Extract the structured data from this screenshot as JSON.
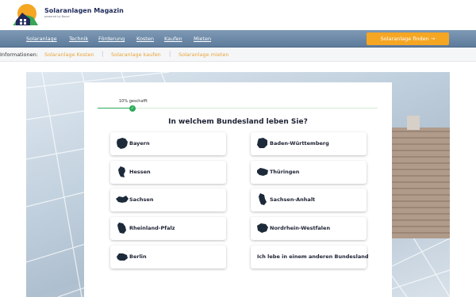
{
  "brand": {
    "title": "Solaranlagen Magazin",
    "subtitle": "powered by Bauer"
  },
  "nav": {
    "items": [
      "Solaranlage",
      "Technik",
      "Förderung",
      "Kosten",
      "Kaufen",
      "Mieten"
    ],
    "cta_label": "Solaranlage finden",
    "cta_arrow": "→"
  },
  "infobar": {
    "label": "Informationen:",
    "links": [
      "Solaranlage Kosten",
      "Solaranlage kaufen",
      "Solaranlage mieten"
    ],
    "separator": "|"
  },
  "quiz": {
    "progress_label": "10% geschafft",
    "progress_percent": 10,
    "progress_check": "✓",
    "question": "In welchem Bundesland leben Sie?",
    "options": [
      {
        "label": "Bayern",
        "icon": "bayern-map-icon"
      },
      {
        "label": "Baden-Württemberg",
        "icon": "baden-wuerttemberg-map-icon"
      },
      {
        "label": "Hessen",
        "icon": "hessen-map-icon"
      },
      {
        "label": "Thüringen",
        "icon": "thueringen-map-icon"
      },
      {
        "label": "Sachsen",
        "icon": "sachsen-map-icon"
      },
      {
        "label": "Sachsen-Anhalt",
        "icon": "sachsen-anhalt-map-icon"
      },
      {
        "label": "Rheinland-Pfalz",
        "icon": "rheinland-pfalz-map-icon"
      },
      {
        "label": "Nordrhein-Westfalen",
        "icon": "nordrhein-westfalen-map-icon"
      },
      {
        "label": "Berlin",
        "icon": "berlin-map-icon"
      },
      {
        "label": "Ich lebe in einem anderen Bundesland",
        "icon": ""
      }
    ]
  },
  "colors": {
    "nav_bg": "#6f8cab",
    "accent_orange": "#f5a623",
    "progress_green": "#2eab5a",
    "map_icon": "#1d2a3a",
    "text_dark": "#1d2233"
  }
}
